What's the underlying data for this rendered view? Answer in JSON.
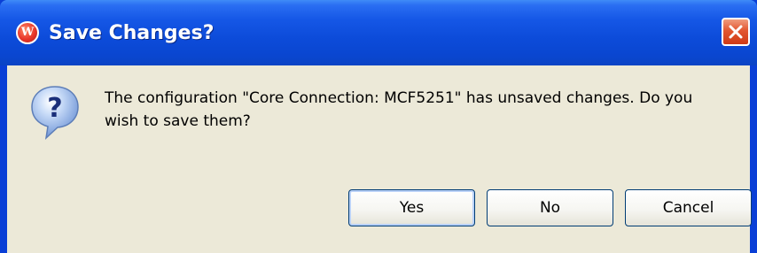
{
  "dialog": {
    "title": "Save Changes?",
    "app_icon": "app-logo-w-icon",
    "app_icon_letter": "W",
    "close_icon": "close-icon",
    "message_icon": "question-icon",
    "message": "The configuration \"Core Connection: MCF5251\" has unsaved changes.  Do you wish to save them?"
  },
  "buttons": {
    "yes": "Yes",
    "no": "No",
    "cancel": "Cancel"
  },
  "colors": {
    "title_bar": "#0c4bd9",
    "dialog_bg": "#ece9d8",
    "close_button": "#e2562f",
    "button_border": "#003c74"
  }
}
